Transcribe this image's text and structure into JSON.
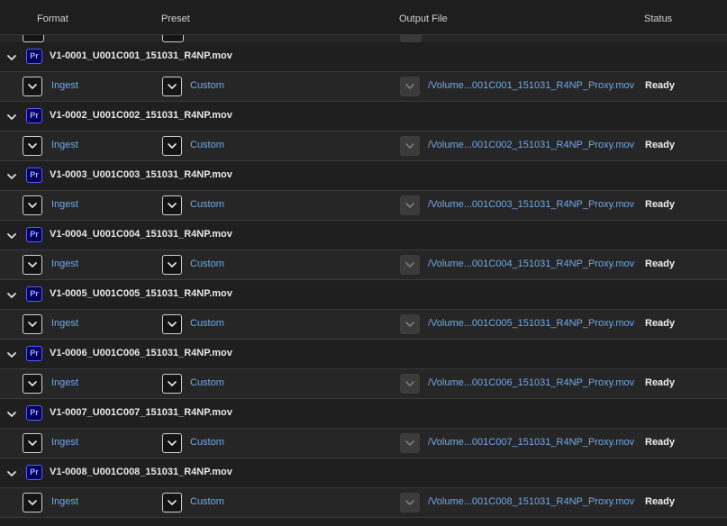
{
  "header": {
    "format": "Format",
    "preset": "Preset",
    "output_file": "Output File",
    "status": "Status"
  },
  "colors": {
    "link": "#6fa9e8",
    "premiere_badge_bg": "#00005b",
    "premiere_badge_text": "#a6a6ff",
    "row_alt_bg": "#262626"
  },
  "groups": [
    {
      "source": "V1-0001_U001C001_151031_R4NP.mov",
      "app_badge": "Pr",
      "format": "Ingest",
      "preset": "Custom",
      "output": "/Volume...001C001_151031_R4NP_Proxy.mov",
      "status": "Ready"
    },
    {
      "source": "V1-0002_U001C002_151031_R4NP.mov",
      "app_badge": "Pr",
      "format": "Ingest",
      "preset": "Custom",
      "output": "/Volume...001C002_151031_R4NP_Proxy.mov",
      "status": "Ready"
    },
    {
      "source": "V1-0003_U001C003_151031_R4NP.mov",
      "app_badge": "Pr",
      "format": "Ingest",
      "preset": "Custom",
      "output": "/Volume...001C003_151031_R4NP_Proxy.mov",
      "status": "Ready"
    },
    {
      "source": "V1-0004_U001C004_151031_R4NP.mov",
      "app_badge": "Pr",
      "format": "Ingest",
      "preset": "Custom",
      "output": "/Volume...001C004_151031_R4NP_Proxy.mov",
      "status": "Ready"
    },
    {
      "source": "V1-0005_U001C005_151031_R4NP.mov",
      "app_badge": "Pr",
      "format": "Ingest",
      "preset": "Custom",
      "output": "/Volume...001C005_151031_R4NP_Proxy.mov",
      "status": "Ready"
    },
    {
      "source": "V1-0006_U001C006_151031_R4NP.mov",
      "app_badge": "Pr",
      "format": "Ingest",
      "preset": "Custom",
      "output": "/Volume...001C006_151031_R4NP_Proxy.mov",
      "status": "Ready"
    },
    {
      "source": "V1-0007_U001C007_151031_R4NP.mov",
      "app_badge": "Pr",
      "format": "Ingest",
      "preset": "Custom",
      "output": "/Volume...001C007_151031_R4NP_Proxy.mov",
      "status": "Ready"
    },
    {
      "source": "V1-0008_U001C008_151031_R4NP.mov",
      "app_badge": "Pr",
      "format": "Ingest",
      "preset": "Custom",
      "output": "/Volume...001C008_151031_R4NP_Proxy.mov",
      "status": "Ready"
    }
  ]
}
